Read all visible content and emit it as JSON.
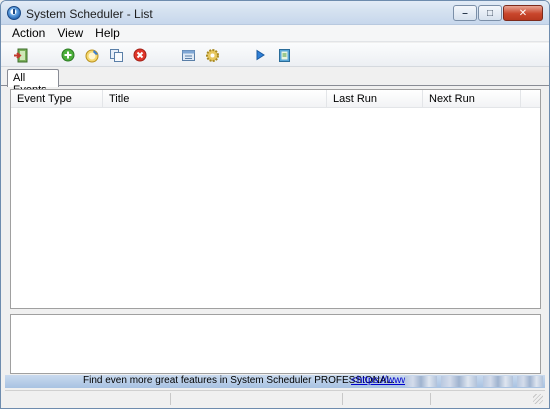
{
  "window": {
    "title": "System Scheduler - List"
  },
  "titlebar_buttons": {
    "minimize": "–",
    "maximize": "□",
    "close": "✕"
  },
  "menu": [
    {
      "label": "Action"
    },
    {
      "label": "View"
    },
    {
      "label": "Help"
    }
  ],
  "toolbar": {
    "icons": [
      "exit-icon",
      "add-event-icon",
      "edit-event-icon",
      "copy-event-icon",
      "delete-event-icon",
      "list-view-icon",
      "settings-icon",
      "run-icon",
      "log-icon"
    ]
  },
  "tabs": [
    {
      "label": "All Events",
      "active": true
    }
  ],
  "list": {
    "columns": [
      "Event Type",
      "Title",
      "Last Run",
      "Next Run"
    ],
    "rows": []
  },
  "promo": {
    "text": "Find even more great features in System Scheduler PROFESSIONAL:",
    "link": "<https://www"
  },
  "colors": {
    "titlebar": "#d4e1f0",
    "close_button": "#c9462c",
    "promo_bar": "#b8cde8",
    "link": "#0000cc"
  }
}
